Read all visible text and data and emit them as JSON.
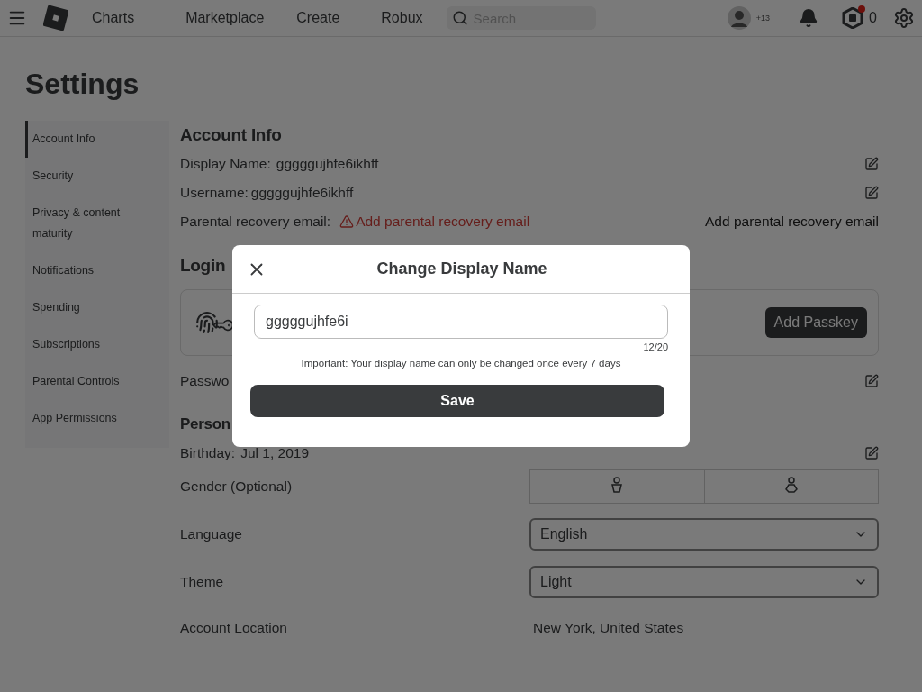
{
  "header": {
    "nav": [
      "Charts",
      "Marketplace",
      "Create",
      "Robux"
    ],
    "search": {
      "placeholder": "Search"
    },
    "friend_count": "+13",
    "robux_balance": "0",
    "robux_notification": true
  },
  "page_title": "Settings",
  "sidebar": {
    "items": [
      {
        "label": "Account Info",
        "selected": true
      },
      {
        "label": "Security",
        "selected": false
      },
      {
        "label": "Privacy & content maturity",
        "selected": false
      },
      {
        "label": "Notifications",
        "selected": false
      },
      {
        "label": "Spending",
        "selected": false
      },
      {
        "label": "Subscriptions",
        "selected": false
      },
      {
        "label": "Parental Controls",
        "selected": false
      },
      {
        "label": "App Permissions",
        "selected": false
      }
    ]
  },
  "account_info": {
    "heading": "Account Info",
    "display_name": {
      "label": "Display Name:",
      "value": "gggggujhfe6ikhff"
    },
    "username": {
      "label": "Username:",
      "value": "gggggujhfe6ikhff"
    },
    "parental_email": {
      "label": "Parental recovery email:",
      "warning": "Add parental recovery email",
      "action": "Add parental recovery email"
    }
  },
  "login": {
    "heading": "Login",
    "passkey_button": "Add Passkey",
    "password_label": "Passwo"
  },
  "personal": {
    "heading": "Person",
    "birthday": {
      "label": "Birthday:",
      "value": "Jul 1, 2019"
    },
    "gender": {
      "label": "Gender (Optional)"
    },
    "language": {
      "label": "Language",
      "value": "English"
    },
    "theme": {
      "label": "Theme",
      "value": "Light"
    },
    "location": {
      "label": "Account Location",
      "value": "New York, United States"
    }
  },
  "dialog": {
    "title": "Change Display Name",
    "input_value": "gggggujhfe6i",
    "counter": "12/20",
    "note": "Important: Your display name can only be changed once every 7 days",
    "save_button": "Save"
  }
}
